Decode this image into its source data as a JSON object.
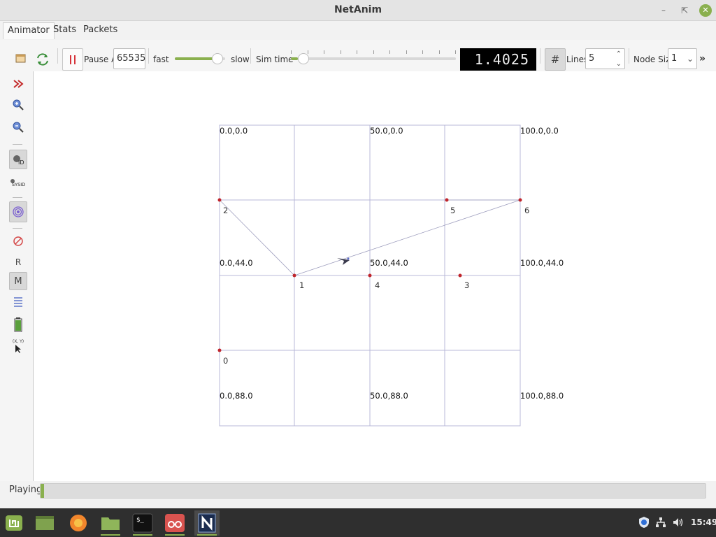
{
  "window": {
    "title": "NetAnim"
  },
  "tabs": [
    "Animator",
    "Stats",
    "Packets"
  ],
  "toolbar": {
    "pause_at_label": "Pause At",
    "pause_at_value": "65535",
    "fast_label": "fast",
    "slow_label": "slow",
    "speed_level": 0.85,
    "sim_time_label": "Sim time",
    "sim_time_value": "1.4025",
    "sim_time_progress": 0.02,
    "lines_label": "Lines",
    "lines_value": "5",
    "node_size_label": "Node Size",
    "node_size_value": "1",
    "more_chevron": "»"
  },
  "left_toolbar": {
    "reset_label": "R",
    "mobility_label": "M",
    "sysid_label": "SYSID",
    "id_label": "ID",
    "xy_label": "(X, Y)"
  },
  "grid": {
    "labels": [
      "0.0,0.0",
      "50.0,0.0",
      "100.0,0.0",
      "0.0,44.0",
      "50.0,44.0",
      "100.0,44.0",
      "0.0,88.0",
      "50.0,88.0",
      "100.0,88.0"
    ]
  },
  "nodes": [
    {
      "id": "0"
    },
    {
      "id": "1"
    },
    {
      "id": "2"
    },
    {
      "id": "3"
    },
    {
      "id": "4"
    },
    {
      "id": "5"
    },
    {
      "id": "6"
    }
  ],
  "status": {
    "text": "Playing",
    "progress": 0.005
  },
  "taskbar": {
    "clock": "15:49"
  },
  "colors": {
    "accent": "#8ab04e",
    "node": "#c0262c",
    "grid": "#b8b8d8"
  }
}
